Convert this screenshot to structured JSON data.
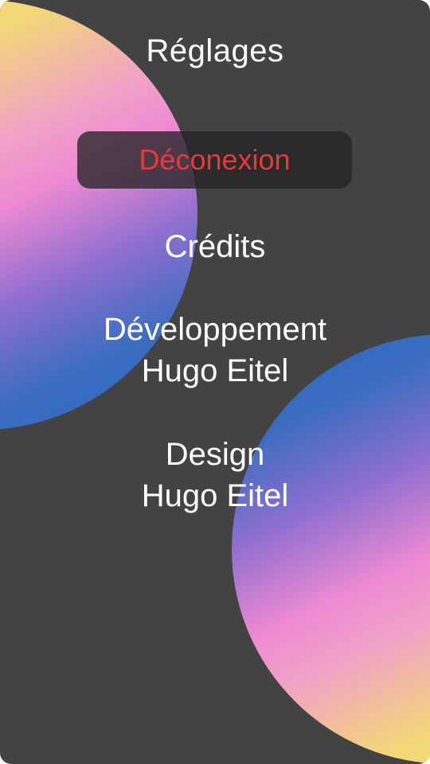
{
  "header": {
    "title": "Réglages"
  },
  "actions": {
    "logout_label": "Déconexion"
  },
  "credits": {
    "heading": "Crédits",
    "development": {
      "role": "Développement",
      "name": "Hugo Eitel"
    },
    "design": {
      "role": "Design",
      "name": "Hugo Eitel"
    }
  },
  "colors": {
    "background": "#434343",
    "button_bg": "#242424",
    "logout_text": "#e8393a",
    "gradient_yellow": "#f2e06e",
    "gradient_pink": "#ee8bd2",
    "gradient_blue": "#2f66be"
  }
}
